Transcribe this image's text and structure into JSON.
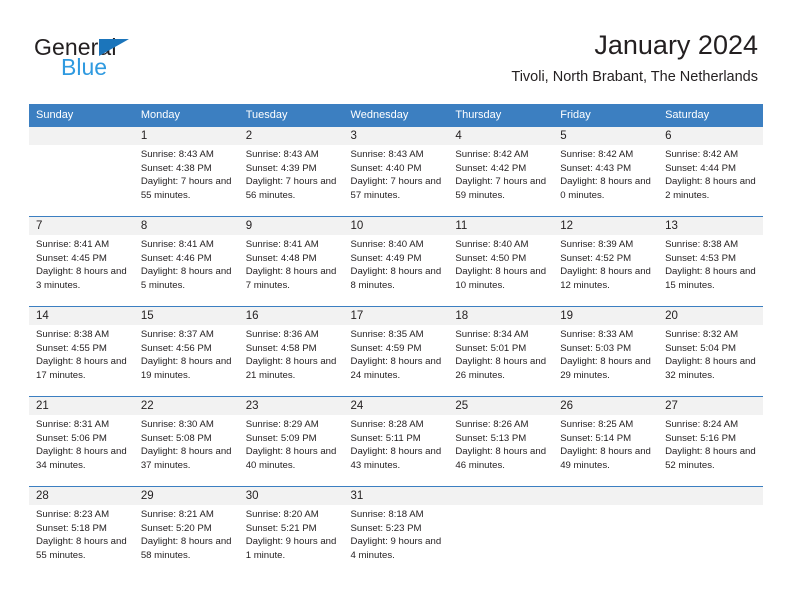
{
  "brand": {
    "name_dark": "General",
    "name_light": "Blue",
    "accent_color": "#1b75bb",
    "light_color": "#2f9ae0"
  },
  "header": {
    "title": "January 2024",
    "subtitle": "Tivoli, North Brabant, The Netherlands"
  },
  "theme": {
    "header_row_bg": "#3c7fc1",
    "header_row_text": "#ffffff",
    "daynum_band_bg": "#f2f2f2",
    "body_text": "#231f20"
  },
  "weekday_headers": [
    "Sunday",
    "Monday",
    "Tuesday",
    "Wednesday",
    "Thursday",
    "Friday",
    "Saturday"
  ],
  "weeks": [
    [
      {
        "day": "",
        "sunrise": "",
        "sunset": "",
        "daylight": "",
        "empty": true
      },
      {
        "day": "1",
        "sunrise": "Sunrise: 8:43 AM",
        "sunset": "Sunset: 4:38 PM",
        "daylight": "Daylight: 7 hours and 55 minutes."
      },
      {
        "day": "2",
        "sunrise": "Sunrise: 8:43 AM",
        "sunset": "Sunset: 4:39 PM",
        "daylight": "Daylight: 7 hours and 56 minutes."
      },
      {
        "day": "3",
        "sunrise": "Sunrise: 8:43 AM",
        "sunset": "Sunset: 4:40 PM",
        "daylight": "Daylight: 7 hours and 57 minutes."
      },
      {
        "day": "4",
        "sunrise": "Sunrise: 8:42 AM",
        "sunset": "Sunset: 4:42 PM",
        "daylight": "Daylight: 7 hours and 59 minutes."
      },
      {
        "day": "5",
        "sunrise": "Sunrise: 8:42 AM",
        "sunset": "Sunset: 4:43 PM",
        "daylight": "Daylight: 8 hours and 0 minutes."
      },
      {
        "day": "6",
        "sunrise": "Sunrise: 8:42 AM",
        "sunset": "Sunset: 4:44 PM",
        "daylight": "Daylight: 8 hours and 2 minutes."
      }
    ],
    [
      {
        "day": "7",
        "sunrise": "Sunrise: 8:41 AM",
        "sunset": "Sunset: 4:45 PM",
        "daylight": "Daylight: 8 hours and 3 minutes."
      },
      {
        "day": "8",
        "sunrise": "Sunrise: 8:41 AM",
        "sunset": "Sunset: 4:46 PM",
        "daylight": "Daylight: 8 hours and 5 minutes."
      },
      {
        "day": "9",
        "sunrise": "Sunrise: 8:41 AM",
        "sunset": "Sunset: 4:48 PM",
        "daylight": "Daylight: 8 hours and 7 minutes."
      },
      {
        "day": "10",
        "sunrise": "Sunrise: 8:40 AM",
        "sunset": "Sunset: 4:49 PM",
        "daylight": "Daylight: 8 hours and 8 minutes."
      },
      {
        "day": "11",
        "sunrise": "Sunrise: 8:40 AM",
        "sunset": "Sunset: 4:50 PM",
        "daylight": "Daylight: 8 hours and 10 minutes."
      },
      {
        "day": "12",
        "sunrise": "Sunrise: 8:39 AM",
        "sunset": "Sunset: 4:52 PM",
        "daylight": "Daylight: 8 hours and 12 minutes."
      },
      {
        "day": "13",
        "sunrise": "Sunrise: 8:38 AM",
        "sunset": "Sunset: 4:53 PM",
        "daylight": "Daylight: 8 hours and 15 minutes."
      }
    ],
    [
      {
        "day": "14",
        "sunrise": "Sunrise: 8:38 AM",
        "sunset": "Sunset: 4:55 PM",
        "daylight": "Daylight: 8 hours and 17 minutes."
      },
      {
        "day": "15",
        "sunrise": "Sunrise: 8:37 AM",
        "sunset": "Sunset: 4:56 PM",
        "daylight": "Daylight: 8 hours and 19 minutes."
      },
      {
        "day": "16",
        "sunrise": "Sunrise: 8:36 AM",
        "sunset": "Sunset: 4:58 PM",
        "daylight": "Daylight: 8 hours and 21 minutes."
      },
      {
        "day": "17",
        "sunrise": "Sunrise: 8:35 AM",
        "sunset": "Sunset: 4:59 PM",
        "daylight": "Daylight: 8 hours and 24 minutes."
      },
      {
        "day": "18",
        "sunrise": "Sunrise: 8:34 AM",
        "sunset": "Sunset: 5:01 PM",
        "daylight": "Daylight: 8 hours and 26 minutes."
      },
      {
        "day": "19",
        "sunrise": "Sunrise: 8:33 AM",
        "sunset": "Sunset: 5:03 PM",
        "daylight": "Daylight: 8 hours and 29 minutes."
      },
      {
        "day": "20",
        "sunrise": "Sunrise: 8:32 AM",
        "sunset": "Sunset: 5:04 PM",
        "daylight": "Daylight: 8 hours and 32 minutes."
      }
    ],
    [
      {
        "day": "21",
        "sunrise": "Sunrise: 8:31 AM",
        "sunset": "Sunset: 5:06 PM",
        "daylight": "Daylight: 8 hours and 34 minutes."
      },
      {
        "day": "22",
        "sunrise": "Sunrise: 8:30 AM",
        "sunset": "Sunset: 5:08 PM",
        "daylight": "Daylight: 8 hours and 37 minutes."
      },
      {
        "day": "23",
        "sunrise": "Sunrise: 8:29 AM",
        "sunset": "Sunset: 5:09 PM",
        "daylight": "Daylight: 8 hours and 40 minutes."
      },
      {
        "day": "24",
        "sunrise": "Sunrise: 8:28 AM",
        "sunset": "Sunset: 5:11 PM",
        "daylight": "Daylight: 8 hours and 43 minutes."
      },
      {
        "day": "25",
        "sunrise": "Sunrise: 8:26 AM",
        "sunset": "Sunset: 5:13 PM",
        "daylight": "Daylight: 8 hours and 46 minutes."
      },
      {
        "day": "26",
        "sunrise": "Sunrise: 8:25 AM",
        "sunset": "Sunset: 5:14 PM",
        "daylight": "Daylight: 8 hours and 49 minutes."
      },
      {
        "day": "27",
        "sunrise": "Sunrise: 8:24 AM",
        "sunset": "Sunset: 5:16 PM",
        "daylight": "Daylight: 8 hours and 52 minutes."
      }
    ],
    [
      {
        "day": "28",
        "sunrise": "Sunrise: 8:23 AM",
        "sunset": "Sunset: 5:18 PM",
        "daylight": "Daylight: 8 hours and 55 minutes."
      },
      {
        "day": "29",
        "sunrise": "Sunrise: 8:21 AM",
        "sunset": "Sunset: 5:20 PM",
        "daylight": "Daylight: 8 hours and 58 minutes."
      },
      {
        "day": "30",
        "sunrise": "Sunrise: 8:20 AM",
        "sunset": "Sunset: 5:21 PM",
        "daylight": "Daylight: 9 hours and 1 minute."
      },
      {
        "day": "31",
        "sunrise": "Sunrise: 8:18 AM",
        "sunset": "Sunset: 5:23 PM",
        "daylight": "Daylight: 9 hours and 4 minutes."
      },
      {
        "day": "",
        "sunrise": "",
        "sunset": "",
        "daylight": "",
        "empty": true
      },
      {
        "day": "",
        "sunrise": "",
        "sunset": "",
        "daylight": "",
        "empty": true
      },
      {
        "day": "",
        "sunrise": "",
        "sunset": "",
        "daylight": "",
        "empty": true
      }
    ]
  ]
}
